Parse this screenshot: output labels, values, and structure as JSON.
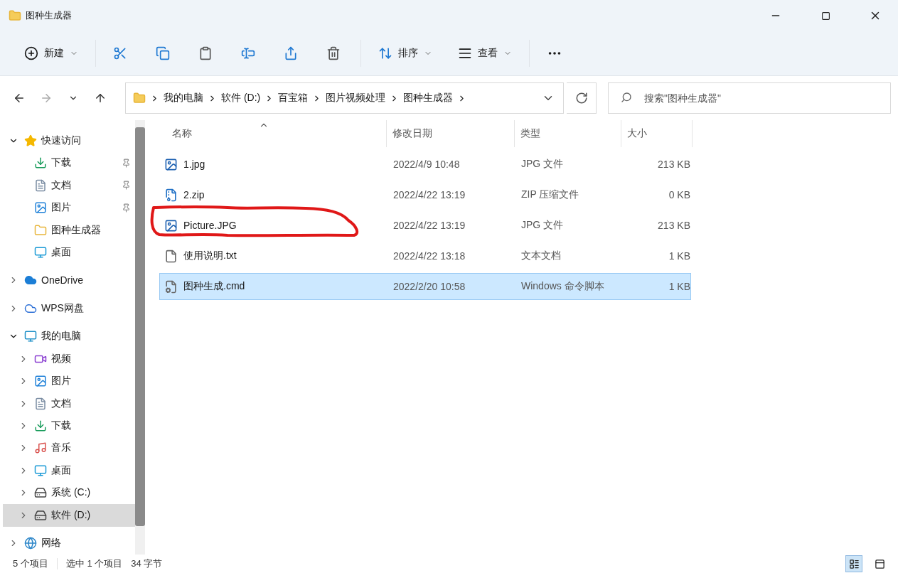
{
  "window": {
    "title": "图种生成器"
  },
  "toolbar": {
    "new_label": "新建",
    "sort_label": "排序",
    "view_label": "查看"
  },
  "address": {
    "breadcrumbs": [
      "我的电脑",
      "软件 (D:)",
      "百宝箱",
      "图片视频处理",
      "图种生成器"
    ]
  },
  "search": {
    "placeholder": "搜索\"图种生成器\""
  },
  "sidebar": {
    "items": [
      {
        "label": "快速访问",
        "kind": "star",
        "expanded": true,
        "selected": false,
        "children": [
          {
            "label": "下载",
            "kind": "download",
            "pinned": true,
            "selected": false
          },
          {
            "label": "文档",
            "kind": "document",
            "pinned": true,
            "selected": false
          },
          {
            "label": "图片",
            "kind": "picture",
            "pinned": true,
            "selected": false
          },
          {
            "label": "图种生成器",
            "kind": "folder",
            "pinned": false,
            "selected": false
          },
          {
            "label": "桌面",
            "kind": "desktop",
            "pinned": false,
            "selected": false
          }
        ]
      },
      {
        "label": "OneDrive",
        "kind": "cloud",
        "expanded": false,
        "selected": false
      },
      {
        "label": "WPS网盘",
        "kind": "cloud-outline",
        "expanded": false,
        "selected": false
      },
      {
        "label": "我的电脑",
        "kind": "computer",
        "expanded": true,
        "selected": false,
        "children": [
          {
            "label": "视频",
            "kind": "video",
            "expanded": false,
            "selected": false
          },
          {
            "label": "图片",
            "kind": "picture",
            "expanded": false,
            "selected": false
          },
          {
            "label": "文档",
            "kind": "document",
            "expanded": false,
            "selected": false
          },
          {
            "label": "下载",
            "kind": "download",
            "expanded": false,
            "selected": false
          },
          {
            "label": "音乐",
            "kind": "music",
            "expanded": false,
            "selected": false
          },
          {
            "label": "桌面",
            "kind": "desktop",
            "expanded": false,
            "selected": false
          },
          {
            "label": "系统 (C:)",
            "kind": "system-drive",
            "expanded": false,
            "selected": false
          },
          {
            "label": "软件 (D:)",
            "kind": "drive",
            "expanded": false,
            "selected": true
          }
        ]
      },
      {
        "label": "网络",
        "kind": "network",
        "expanded": false,
        "selected": false
      }
    ]
  },
  "table": {
    "columns": [
      {
        "label": "名称",
        "sorted": true
      },
      {
        "label": "修改日期",
        "sorted": false
      },
      {
        "label": "类型",
        "sorted": false
      },
      {
        "label": "大小",
        "sorted": false
      }
    ],
    "rows": [
      {
        "name": "1.jpg",
        "kind": "image",
        "date": "2022/4/9 10:48",
        "type": "JPG 文件",
        "size": "213 KB",
        "selected": false
      },
      {
        "name": "2.zip",
        "kind": "zip",
        "date": "2022/4/22 13:19",
        "type": "ZIP 压缩文件",
        "size": "0 KB",
        "selected": false
      },
      {
        "name": "Picture.JPG",
        "kind": "image",
        "date": "2022/4/22 13:19",
        "type": "JPG 文件",
        "size": "213 KB",
        "selected": false
      },
      {
        "name": "使用说明.txt",
        "kind": "text",
        "date": "2022/4/22 13:18",
        "type": "文本文档",
        "size": "1 KB",
        "selected": false
      },
      {
        "name": "图种生成.cmd",
        "kind": "script",
        "date": "2022/2/20 10:58",
        "type": "Windows 命令脚本",
        "size": "1 KB",
        "selected": true
      }
    ]
  },
  "status_bar": {
    "item_count": "5 个项目",
    "selection": "选中 1 个项目",
    "selection_size": "34 字节",
    "view_modes": [
      {
        "kind": "details",
        "selected": true
      },
      {
        "kind": "tiles",
        "selected": false
      }
    ]
  }
}
